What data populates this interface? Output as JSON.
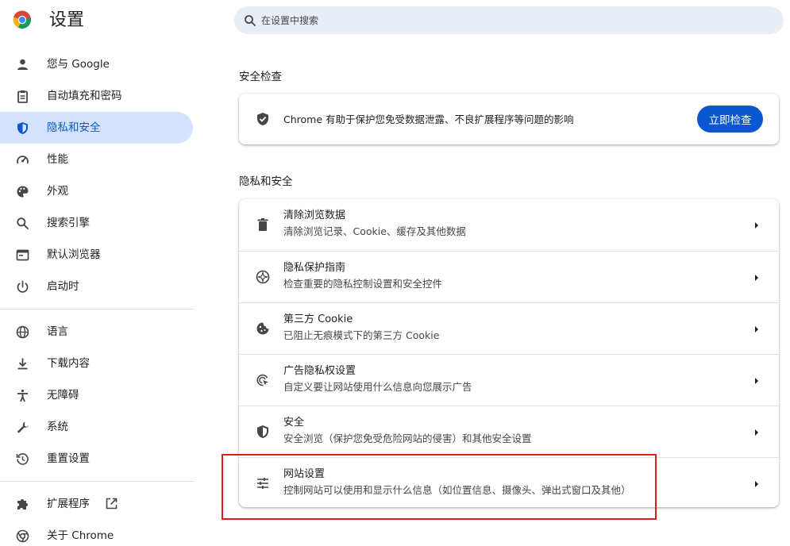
{
  "header": {
    "title": "设置",
    "logo_icon": "chrome-logo-icon",
    "search": {
      "placeholder": "在设置中搜索",
      "icon": "search-icon"
    }
  },
  "sidebar": {
    "items": [
      {
        "label": "您与 Google",
        "icon": "person-icon"
      },
      {
        "label": "自动填充和密码",
        "icon": "clipboard-icon"
      },
      {
        "label": "隐私和安全",
        "icon": "shield-icon",
        "active": true
      },
      {
        "label": "性能",
        "icon": "speedometer-icon"
      },
      {
        "label": "外观",
        "icon": "palette-icon"
      },
      {
        "label": "搜索引擎",
        "icon": "search-icon"
      },
      {
        "label": "默认浏览器",
        "icon": "browser-icon"
      },
      {
        "label": "启动时",
        "icon": "power-icon"
      }
    ],
    "advanced_items": [
      {
        "label": "语言",
        "icon": "globe-icon"
      },
      {
        "label": "下载内容",
        "icon": "download-icon"
      },
      {
        "label": "无障碍",
        "icon": "accessibility-icon"
      },
      {
        "label": "系统",
        "icon": "wrench-icon"
      },
      {
        "label": "重置设置",
        "icon": "reset-icon"
      }
    ],
    "footer_items": [
      {
        "label": "扩展程序",
        "icon": "puzzle-icon",
        "external_icon": "open-in-new-icon"
      },
      {
        "label": "关于 Chrome",
        "icon": "chrome-icon"
      }
    ]
  },
  "safety_check": {
    "heading": "安全检查",
    "text": "Chrome 有助于保护您免受数据泄露、不良扩展程序等问题的影响",
    "button_label": "立即检查",
    "icon": "shield-check-icon"
  },
  "privacy": {
    "heading": "隐私和安全",
    "rows": [
      {
        "title": "清除浏览数据",
        "subtitle": "清除浏览记录、Cookie、缓存及其他数据",
        "icon": "trash-icon"
      },
      {
        "title": "隐私保护指南",
        "subtitle": "检查重要的隐私控制设置和安全控件",
        "icon": "compass-icon"
      },
      {
        "title": "第三方 Cookie",
        "subtitle": "已阻止无痕模式下的第三方 Cookie",
        "icon": "cookie-icon"
      },
      {
        "title": "广告隐私权设置",
        "subtitle": "自定义要让网站使用什么信息向您展示广告",
        "icon": "ad-privacy-icon"
      },
      {
        "title": "安全",
        "subtitle": "安全浏览（保护您免受危险网站的侵害）和其他安全设置",
        "icon": "shield-icon"
      },
      {
        "title": "网站设置",
        "subtitle": "控制网站可以使用和显示什么信息（如位置信息、摄像头、弹出式窗口及其他）",
        "icon": "tune-icon",
        "highlighted": true
      }
    ]
  },
  "colors": {
    "accent": "#0b57d0",
    "active_bg": "#d3e3fd",
    "search_bg": "#e9eef6",
    "highlight_border": "#e01b1b"
  }
}
